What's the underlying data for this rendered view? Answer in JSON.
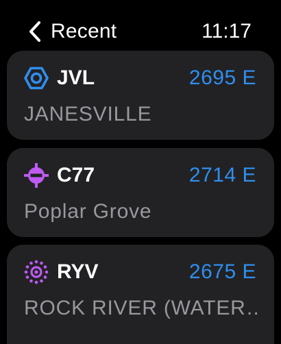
{
  "header": {
    "back_label": "Recent",
    "time": "11:17"
  },
  "airports": [
    {
      "ident": "JVL",
      "frequency": "2695 E",
      "name": "JANESVILLE",
      "icon": "hexagon-airport-icon",
      "icon_color": "#2f8ff0"
    },
    {
      "ident": "C77",
      "frequency": "2714 E",
      "name": "Poplar Grove",
      "icon": "private-airport-icon",
      "icon_color": "#bf5af2"
    },
    {
      "ident": "RYV",
      "frequency": "2675 E",
      "name": "ROCK RIVER (WATER…",
      "icon": "seaplane-base-icon",
      "icon_color": "#bf5af2"
    }
  ],
  "colors": {
    "background": "#000000",
    "card": "#222224",
    "frequency": "#2f8ff0",
    "secondary_text": "#98989e"
  }
}
